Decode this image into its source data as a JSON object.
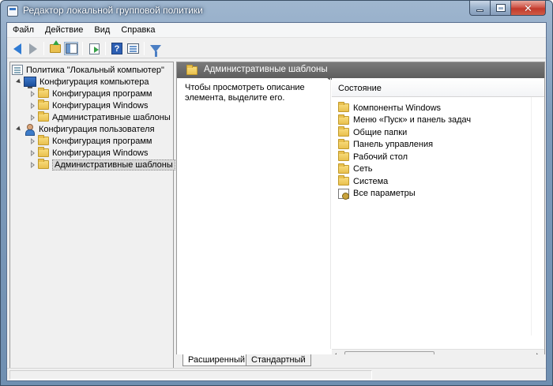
{
  "window": {
    "title": "Редактор локальной групповой политики"
  },
  "menu": {
    "items": [
      "Файл",
      "Действие",
      "Вид",
      "Справка"
    ]
  },
  "toolbar": {
    "buttons": [
      "back-icon",
      "forward-icon",
      "up-folder-icon",
      "show-hide-tree-icon",
      "export-list-icon",
      "help-icon",
      "properties-icon",
      "filter-icon"
    ]
  },
  "tree": {
    "root": "Политика \"Локальный компьютер\"",
    "computer_config": "Конфигурация компьютера",
    "computer_children": [
      "Конфигурация программ",
      "Конфигурация Windows",
      "Административные шаблоны"
    ],
    "user_config": "Конфигурация пользователя",
    "user_children": [
      "Конфигурация программ",
      "Конфигурация Windows",
      "Административные шаблоны"
    ]
  },
  "right_pane": {
    "header_title": "Административные шаблоны",
    "description": "Чтобы просмотреть описание элемента, выделите его.",
    "column_header": "Состояние",
    "items": [
      "Компоненты Windows",
      "Меню «Пуск» и панель задач",
      "Общие папки",
      "Панель управления",
      "Рабочий стол",
      "Сеть",
      "Система",
      "Все параметры"
    ]
  },
  "tabs": [
    "Расширенный",
    "Стандартный"
  ]
}
